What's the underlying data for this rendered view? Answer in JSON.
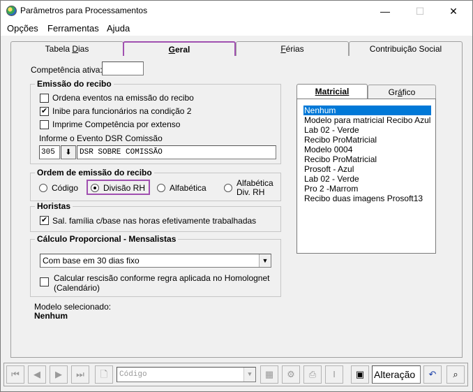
{
  "window": {
    "title": "Parâmetros para Processamentos",
    "minimize": "—",
    "maximize": "☐",
    "close": "✕"
  },
  "menu": [
    "Opções",
    "Ferramentas",
    "Ajuda"
  ],
  "tabs": [
    {
      "label_pre": "Tabela ",
      "label_u": "D",
      "label_post": "ias"
    },
    {
      "label_pre": "",
      "label_u": "G",
      "label_post": "eral"
    },
    {
      "label_pre": "",
      "label_u": "F",
      "label_post": "érias"
    },
    {
      "label_pre": "Contribuição Social",
      "label_u": "",
      "label_post": ""
    }
  ],
  "competencia": {
    "label": "Competência ativa:",
    "value": ""
  },
  "emissao": {
    "title": "Emissão do recibo",
    "options": [
      {
        "label": "Ordena eventos na emissão do recibo",
        "checked": false
      },
      {
        "label": "Inibe para funcionários na condição 2",
        "checked": true
      },
      {
        "label": "Imprime Competência por extenso",
        "checked": false
      }
    ],
    "dsr_label": "Informe o Evento DSR Comissão",
    "dsr_code": "305",
    "dsr_desc": "DSR SOBRE COMISSÃO"
  },
  "ordem": {
    "title": "Ordem de emissão do recibo",
    "opt1": "Código",
    "opt2": "Divisão RH",
    "opt3": "Alfabética",
    "opt4_line1": "Alfabética",
    "opt4_line2": "Div.  RH",
    "selected": "Divisão RH"
  },
  "horistas": {
    "title": "Horistas",
    "option": "Sal. família c/base nas horas efetivamente trabalhadas",
    "checked": true
  },
  "calculo": {
    "title": "Cálculo Proporcional - Mensalistas",
    "select_value": "Com base em 30 dias fixo",
    "check_line1": "Calcular rescisão conforme regra aplicada no Homolognet",
    "check_line2": "(Calendário)",
    "checked": false
  },
  "modelo": {
    "label": "Modelo selecionado:",
    "value": "Nenhum"
  },
  "right_tabs": {
    "matricial": "Matricial",
    "grafico_pre": "Gr",
    "grafico_u": "á",
    "grafico_post": "fico"
  },
  "list_items": [
    "Nenhum",
    "Modelo para matricial Recibo Azul",
    "Lab 02 - Verde",
    "Recibo ProMatricial",
    "Modelo 0004",
    "Recibo ProMatricial",
    "Prosoft - Azul",
    "Lab 02 - Verde",
    "Pro 2 -Marrom",
    "Recibo duas imagens Prosoft13"
  ],
  "toolbar": {
    "combo_placeholder": "Código",
    "status": "Alteração"
  },
  "colors": {
    "accent_tab_border": "#a050b0",
    "list_selection": "#0078d7"
  }
}
